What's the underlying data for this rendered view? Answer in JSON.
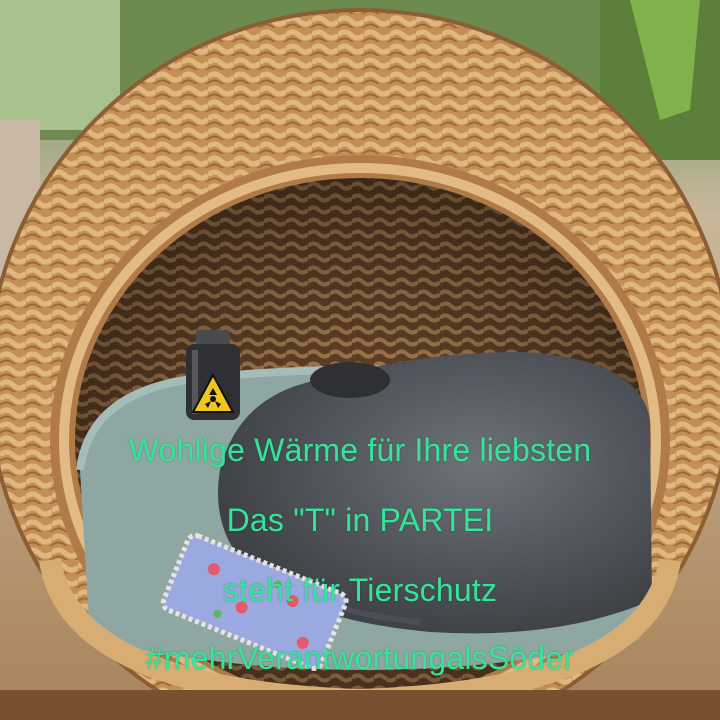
{
  "caption": {
    "line1": "Wohlige Wärme für Ihre liebsten",
    "line2": "Das \"T\" in PARTEI",
    "line3": "steht für Tierschutz",
    "line4": "#mehrVerantwortungalsSöder"
  },
  "colors": {
    "caption_text": "#35e39a",
    "wicker": "#c89a63",
    "cat_fur": "#5c6066",
    "blanket": "#8fa7a3",
    "flask": "#2f3033",
    "hazard_sign": "#f2c61f"
  },
  "icons": {
    "flask_symbol": "radiation-hazard-icon"
  }
}
